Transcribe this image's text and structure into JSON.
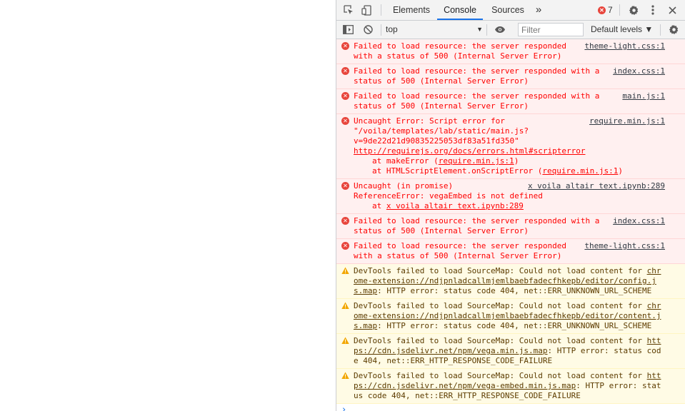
{
  "devtools": {
    "tabs": [
      {
        "label": "Elements"
      },
      {
        "label": "Console"
      },
      {
        "label": "Sources"
      }
    ],
    "more_tabs": "»",
    "error_count": "7",
    "toolbar": {
      "context": "top",
      "filter_placeholder": "Filter",
      "levels": "Default levels ▼"
    }
  },
  "messages": [
    {
      "type": "error",
      "src": "theme-light.css:1",
      "lines": [
        "Failed to load resource: the server responded",
        "with a status of 500 (Internal Server Error)"
      ]
    },
    {
      "type": "error",
      "src": "index.css:1",
      "lines": [
        "Failed to load resource: the server responded with a",
        "status of 500 (Internal Server Error)"
      ]
    },
    {
      "type": "error",
      "src": "main.js:1",
      "lines": [
        "Failed to load resource: the server responded with a",
        "status of 500 (Internal Server Error)"
      ]
    },
    {
      "type": "error",
      "src": "require.min.js:1",
      "lines": [
        "Uncaught Error: Script error for",
        "\"/voila/templates/lab/static/main.js?",
        "v=9de22d21d90835225053df83a51fd350\""
      ],
      "link": "http://requirejs.org/docs/errors.html#scripterror",
      "stack": [
        {
          "pre": "at makeError (",
          "ref": "require.min.js:1",
          "post": ")"
        },
        {
          "pre": "at HTMLScriptElement.onScriptError (",
          "ref": "require.min.js:1",
          "post": ")"
        }
      ]
    },
    {
      "type": "error",
      "src": "x voila altair text.ipynb:289",
      "lines": [
        "Uncaught (in promise)",
        "ReferenceError: vegaEmbed is not defined"
      ],
      "stack": [
        {
          "pre": "at ",
          "ref": "x voila altair text.ipynb:289",
          "post": ""
        }
      ]
    },
    {
      "type": "error",
      "src": "index.css:1",
      "lines": [
        "Failed to load resource: the server responded with a",
        "status of 500 (Internal Server Error)"
      ]
    },
    {
      "type": "error",
      "src": "theme-light.css:1",
      "lines": [
        "Failed to load resource: the server responded",
        "with a status of 500 (Internal Server Error)"
      ]
    },
    {
      "type": "warn",
      "pre": "DevTools failed to load SourceMap: Could not load content for ",
      "link": "chrome-extension://ndjpnladcallmjemlbaebfadecfhkepb/editor/config.js.map",
      "post": ": HTTP error: status code 404, net::ERR_UNKNOWN_URL_SCHEME"
    },
    {
      "type": "warn",
      "pre": "DevTools failed to load SourceMap: Could not load content for ",
      "link": "chrome-extension://ndjpnladcallmjemlbaebfadecfhkepb/editor/content.js.map",
      "post": ": HTTP error: status code 404, net::ERR_UNKNOWN_URL_SCHEME"
    },
    {
      "type": "warn",
      "pre": "DevTools failed to load SourceMap: Could not load content for ",
      "link": "https://cdn.jsdelivr.net/npm/vega.min.js.map",
      "post": ": HTTP error: status code 404, net::ERR_HTTP_RESPONSE_CODE_FAILURE"
    },
    {
      "type": "warn",
      "pre": "DevTools failed to load SourceMap: Could not load content for ",
      "link": "https://cdn.jsdelivr.net/npm/vega-embed.min.js.map",
      "post": ": HTTP error: status code 404, net::ERR_HTTP_RESPONSE_CODE_FAILURE"
    }
  ],
  "prompt_caret": "›"
}
